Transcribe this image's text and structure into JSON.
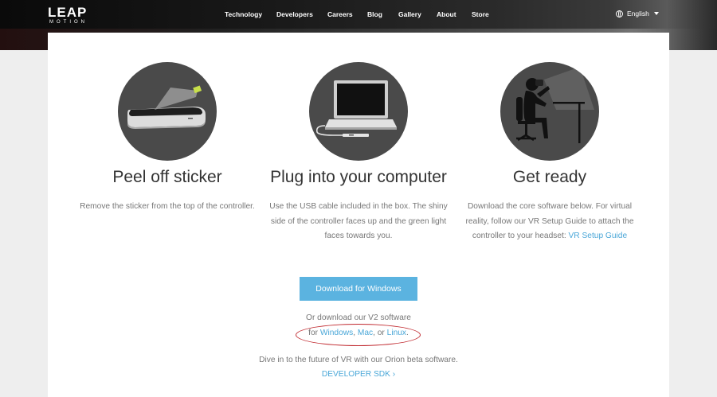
{
  "brand": {
    "name": "LEAP",
    "sub": "MOTION"
  },
  "nav": {
    "items": [
      {
        "label": "Technology"
      },
      {
        "label": "Developers"
      },
      {
        "label": "Careers"
      },
      {
        "label": "Blog"
      },
      {
        "label": "Gallery"
      },
      {
        "label": "About"
      },
      {
        "label": "Store"
      }
    ],
    "language": "English"
  },
  "steps": [
    {
      "title": "Peel off sticker",
      "desc_lines": [
        "Remove the sticker from the top of the controller."
      ]
    },
    {
      "title": "Plug into your computer",
      "desc_lines": [
        "Use the USB cable included in the box. The shiny",
        "side of the controller faces up and the green light",
        "faces towards you."
      ]
    },
    {
      "title": "Get ready",
      "desc_lines": [
        "Download the core software below. For virtual",
        "reality, follow our VR Setup Guide to attach the",
        "controller to your headset: "
      ],
      "link": "VR Setup Guide"
    }
  ],
  "download": {
    "button_label": "Download for Windows",
    "v2_text": "Or download our V2 software",
    "for_text": "for ",
    "windows": "Windows",
    "sep1": ", ",
    "mac": "Mac",
    "sep2": ", or ",
    "linux": "Linux",
    "end": ".",
    "orion_text": "Dive in to the future of VR with our Orion beta software.",
    "sdk_link": "DEVELOPER SDK ›"
  },
  "colors": {
    "accent": "#5bb3e0",
    "link": "#4aa7d8",
    "annotation": "#c0282e",
    "sticker_green": "#c8e04a"
  }
}
